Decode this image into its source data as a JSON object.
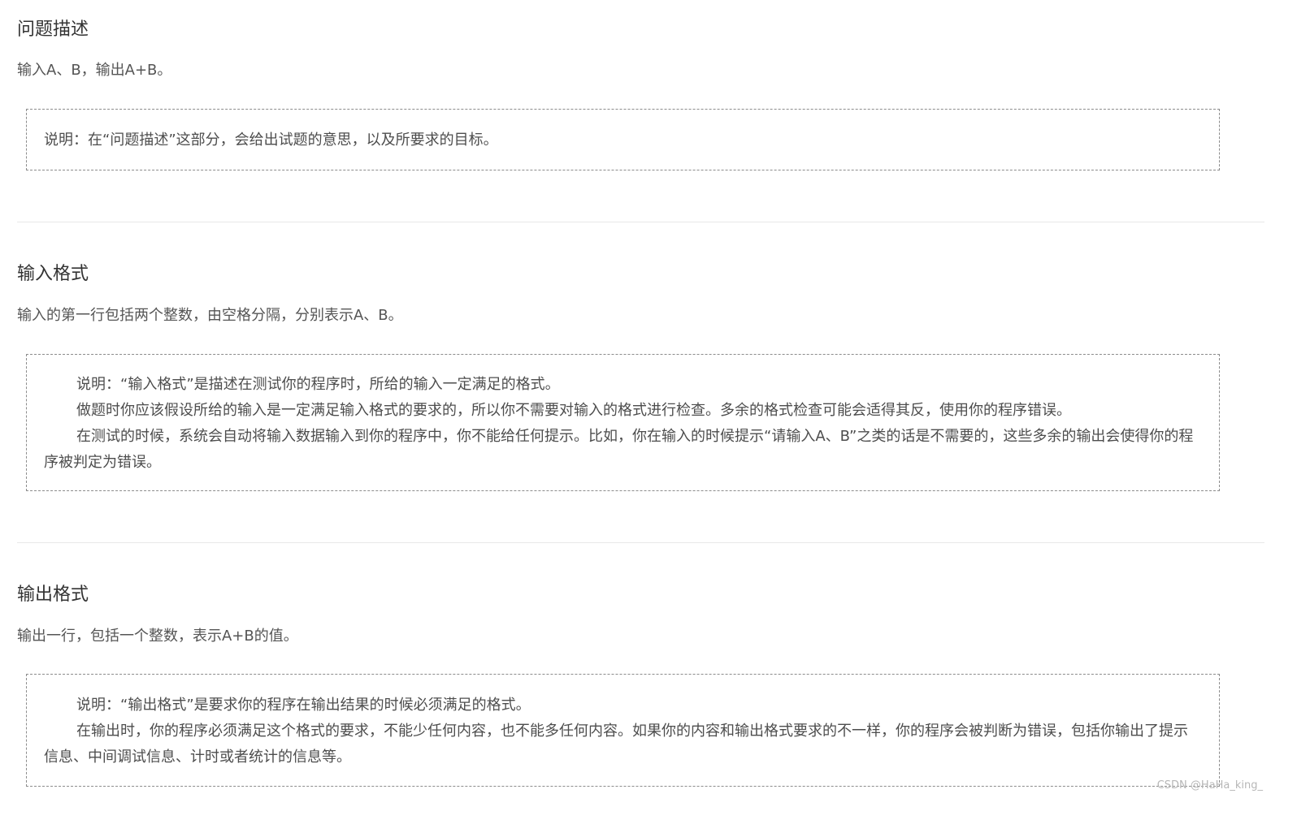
{
  "sections": [
    {
      "title": "问题描述",
      "description": "输入A、B，输出A+B。",
      "note_paragraphs": [
        "说明：在“问题描述”这部分，会给出试题的意思，以及所要求的目标。"
      ]
    },
    {
      "title": "输入格式",
      "description": "输入的第一行包括两个整数，由空格分隔，分别表示A、B。",
      "note_paragraphs": [
        "说明：“输入格式”是描述在测试你的程序时，所给的输入一定满足的格式。",
        "做题时你应该假设所给的输入是一定满足输入格式的要求的，所以你不需要对输入的格式进行检查。多余的格式检查可能会适得其反，使用你的程序错误。",
        "在测试的时候，系统会自动将输入数据输入到你的程序中，你不能给任何提示。比如，你在输入的时候提示“请输入A、B”之类的话是不需要的，这些多余的输出会使得你的程序被判定为错误。"
      ]
    },
    {
      "title": "输出格式",
      "description": "输出一行，包括一个整数，表示A+B的值。",
      "note_paragraphs": [
        "说明：“输出格式”是要求你的程序在输出结果的时候必须满足的格式。",
        "在输出时，你的程序必须满足这个格式的要求，不能少任何内容，也不能多任何内容。如果你的内容和输出格式要求的不一样，你的程序会被判断为错误，包括你输出了提示信息、中间调试信息、计时或者统计的信息等。"
      ]
    }
  ],
  "watermark": "CSDN @HaHa_king_"
}
